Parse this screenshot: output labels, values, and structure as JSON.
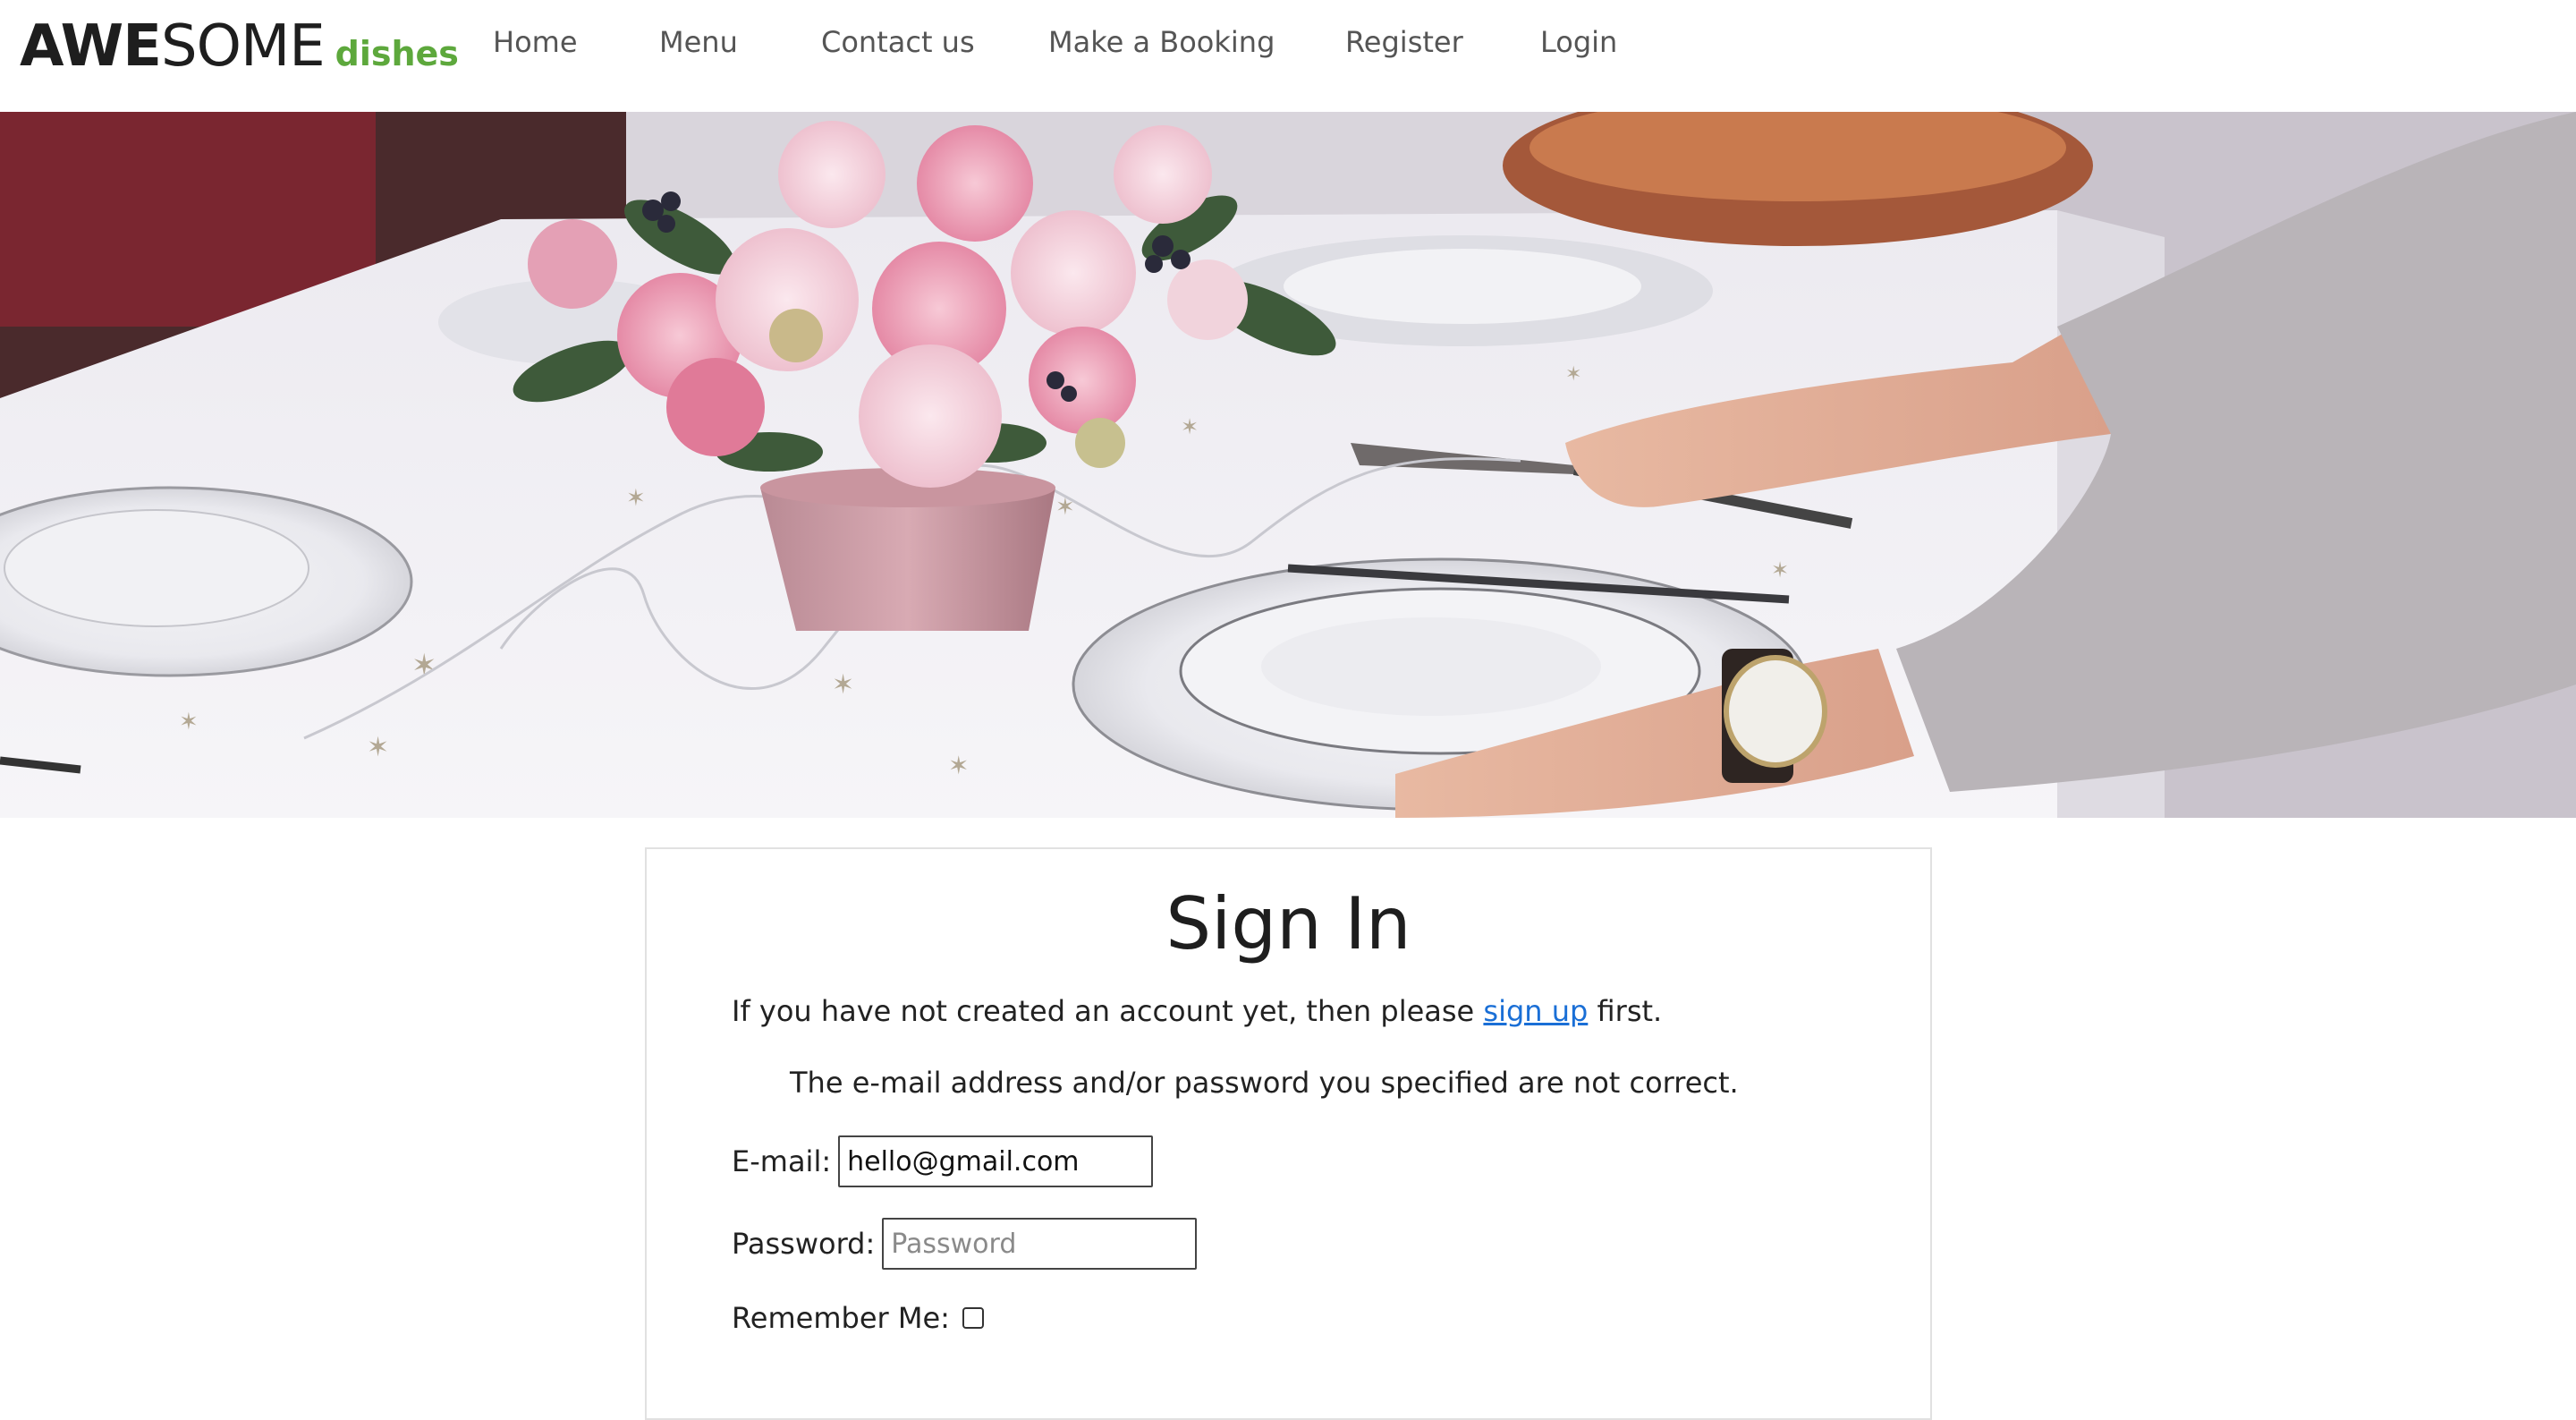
{
  "brand": {
    "part_bold": "AWE",
    "part_light": "SOME",
    "tagline": "dishes",
    "accent_color": "#5da83c"
  },
  "nav": {
    "items": [
      {
        "label": "Home"
      },
      {
        "label": "Menu"
      },
      {
        "label": "Contact us"
      },
      {
        "label": "Make a Booking"
      },
      {
        "label": "Register"
      },
      {
        "label": "Login"
      }
    ]
  },
  "hero": {
    "image": "table-setting-photo"
  },
  "signin": {
    "title": "Sign In",
    "intro_before": "If you have not created an account yet, then please ",
    "signup_link": "sign up",
    "intro_after": " first.",
    "error": "The e-mail address and/or password you specified are not correct.",
    "email_label": "E-mail:",
    "email_value": "hello@gmail.com",
    "password_label": "Password:",
    "password_placeholder": "Password",
    "remember_label": "Remember Me:",
    "remember_checked": false
  },
  "colors": {
    "link": "#1a6fd6",
    "nav_text": "#555555"
  }
}
